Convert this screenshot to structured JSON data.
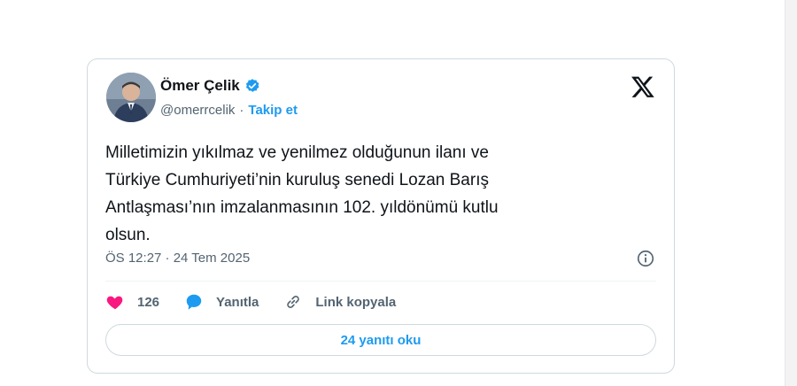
{
  "author": {
    "name": "Ömer Çelik",
    "handle": "@omerrcelik",
    "separator": "·",
    "follow_label": "Takip et"
  },
  "tweet": {
    "text_lines": [
      "Milletimizin yıkılmaz ve yenilmez olduğunun ilanı ve",
      "Türkiye Cumhuriyeti’nin kuruluş senedi Lozan Barış",
      "Antlaşması’nın imzalanmasının 102. yıldönümü kutlu",
      "olsun."
    ],
    "timestamp": "ÖS 12:27 · 24 Tem 2025"
  },
  "actions": {
    "like_count": "126",
    "reply_label": "Yanıtla",
    "copy_link_label": "Link kopyala"
  },
  "replies_button_label": "24 yanıtı oku",
  "colors": {
    "accent": "#1d9bf0",
    "like": "#f91880",
    "text": "#0f1419",
    "muted": "#536471",
    "border": "#cfd9de"
  },
  "icons": [
    "verified-badge-icon",
    "x-logo-icon",
    "info-icon",
    "heart-icon",
    "reply-bubble-icon",
    "link-icon"
  ]
}
